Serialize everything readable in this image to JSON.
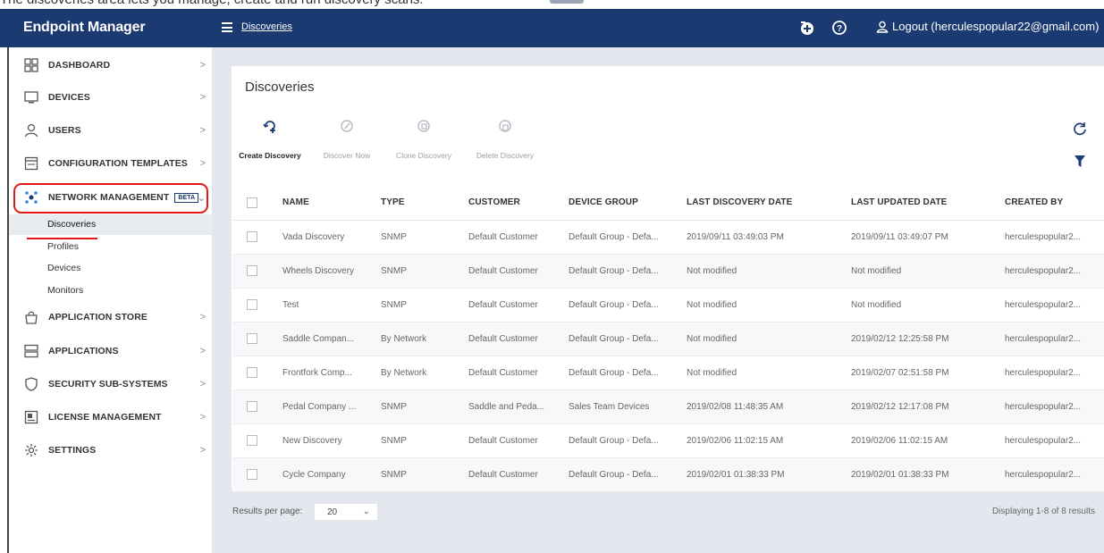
{
  "caption": "The discoveries area lets you manage, create and run discovery scans.",
  "topbar": {
    "brand": "Endpoint Manager",
    "breadcrumb": "Discoveries",
    "logout_label": "Logout (herculespopular22@gmail.com)"
  },
  "sidebar": {
    "items": [
      {
        "label": "DASHBOARD",
        "icon": "dashboard-grid-icon"
      },
      {
        "label": "DEVICES",
        "icon": "monitor-icon"
      },
      {
        "label": "USERS",
        "icon": "user-icon"
      },
      {
        "label": "CONFIGURATION TEMPLATES",
        "icon": "template-icon"
      },
      {
        "label": "NETWORK MANAGEMENT",
        "icon": "network-icon",
        "badge": "BETA"
      },
      {
        "label": "APPLICATION STORE",
        "icon": "store-icon"
      },
      {
        "label": "APPLICATIONS",
        "icon": "applications-icon"
      },
      {
        "label": "SECURITY SUB-SYSTEMS",
        "icon": "shield-icon"
      },
      {
        "label": "LICENSE MANAGEMENT",
        "icon": "license-icon"
      },
      {
        "label": "SETTINGS",
        "icon": "gear-icon"
      }
    ],
    "subitems": [
      "Discoveries",
      "Profiles",
      "Devices",
      "Monitors"
    ]
  },
  "main": {
    "title": "Discoveries",
    "actions": [
      "Create Discovery",
      "Discover Now",
      "Clone Discovery",
      "Delete Discovery"
    ],
    "columns": [
      "NAME",
      "TYPE",
      "CUSTOMER",
      "DEVICE GROUP",
      "LAST DISCOVERY DATE",
      "LAST UPDATED DATE",
      "CREATED BY"
    ],
    "rows": [
      [
        "Vada Discovery",
        "SNMP",
        "Default Customer",
        "Default Group - Defa...",
        "2019/09/11 03:49:03 PM",
        "2019/09/11 03:49:07 PM",
        "herculespopular2..."
      ],
      [
        "Wheels Discovery",
        "SNMP",
        "Default Customer",
        "Default Group - Defa...",
        "Not modified",
        "Not modified",
        "herculespopular2..."
      ],
      [
        "Test",
        "SNMP",
        "Default Customer",
        "Default Group - Defa...",
        "Not modified",
        "Not modified",
        "herculespopular2..."
      ],
      [
        "Saddle Compan...",
        "By Network",
        "Default Customer",
        "Default Group - Defa...",
        "Not modified",
        "2019/02/12 12:25:58 PM",
        "herculespopular2..."
      ],
      [
        "Frontfork Comp...",
        "By Network",
        "Default Customer",
        "Default Group - Defa...",
        "Not modified",
        "2019/02/07 02:51:58 PM",
        "herculespopular2..."
      ],
      [
        "Pedal Company ...",
        "SNMP",
        "Saddle and Peda...",
        "Sales Team Devices",
        "2019/02/08 11:48:35 AM",
        "2019/02/12 12:17:08 PM",
        "herculespopular2..."
      ],
      [
        "New Discovery",
        "SNMP",
        "Default Customer",
        "Default Group - Defa...",
        "2019/02/06 11:02:15 AM",
        "2019/02/06 11:02:15 AM",
        "herculespopular2..."
      ],
      [
        "Cycle Company",
        "SNMP",
        "Default Customer",
        "Default Group - Defa...",
        "2019/02/01 01:38:33 PM",
        "2019/02/01 01:38:33 PM",
        "herculespopular2..."
      ]
    ],
    "results_label": "Results per page:",
    "per_page": "20",
    "displaying": "Displaying 1-8 of 8 results"
  },
  "colors": {
    "nav": "#1c3a72",
    "link": "#2f61b6",
    "highlight": "#e01818",
    "content_bg": "#e4e8ee"
  }
}
